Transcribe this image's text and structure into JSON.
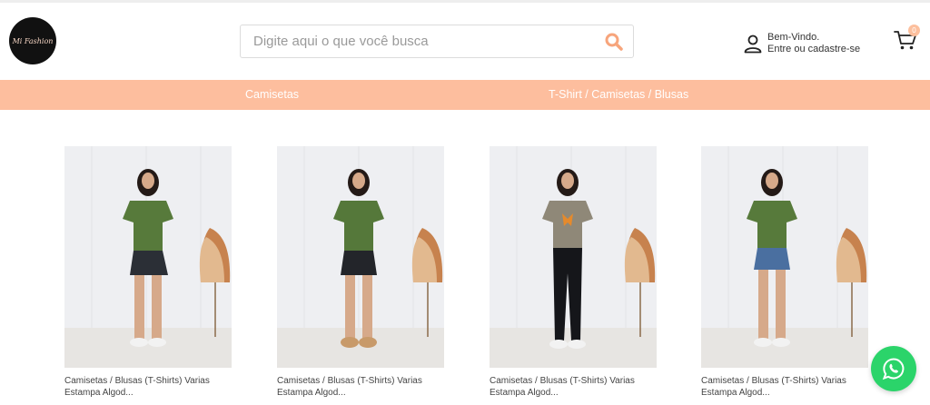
{
  "header": {
    "logo_text": "Mi Fashion",
    "search": {
      "placeholder": "Digite aqui o que você busca",
      "value": ""
    },
    "account": {
      "greeting": "Bem-Vindo.",
      "action": "Entre ou cadastre-se"
    },
    "cart": {
      "count": "0"
    }
  },
  "nav": {
    "items": [
      {
        "label": "Camisetas"
      },
      {
        "label": "T-Shirt / Camisetas / Blusas"
      }
    ]
  },
  "products": [
    {
      "line1": "Camisetas / Blusas (T-Shirts) Varias",
      "line2": "Estampa Algod...",
      "shirt": "#577a3b",
      "bottom": "#2b2f36"
    },
    {
      "line1": "Camisetas / Blusas (T-Shirts) Varias",
      "line2": "Estampa Algod...",
      "shirt": "#55783a",
      "bottom": "#23252a"
    },
    {
      "line1": "Camisetas / Blusas (T-Shirts) Varias",
      "line2": "Estampa Algod...",
      "shirt": "#8f8878",
      "bottom": "#15161a"
    },
    {
      "line1": "Camisetas / Blusas (T-Shirts) Varias",
      "line2": "Estampa Algod...",
      "shirt": "#577a3b",
      "bottom": "#4a6fa0"
    }
  ],
  "colors": {
    "accent": "#fdbe9e",
    "search_icon": "#f7a57c",
    "whatsapp": "#2bd46a"
  }
}
